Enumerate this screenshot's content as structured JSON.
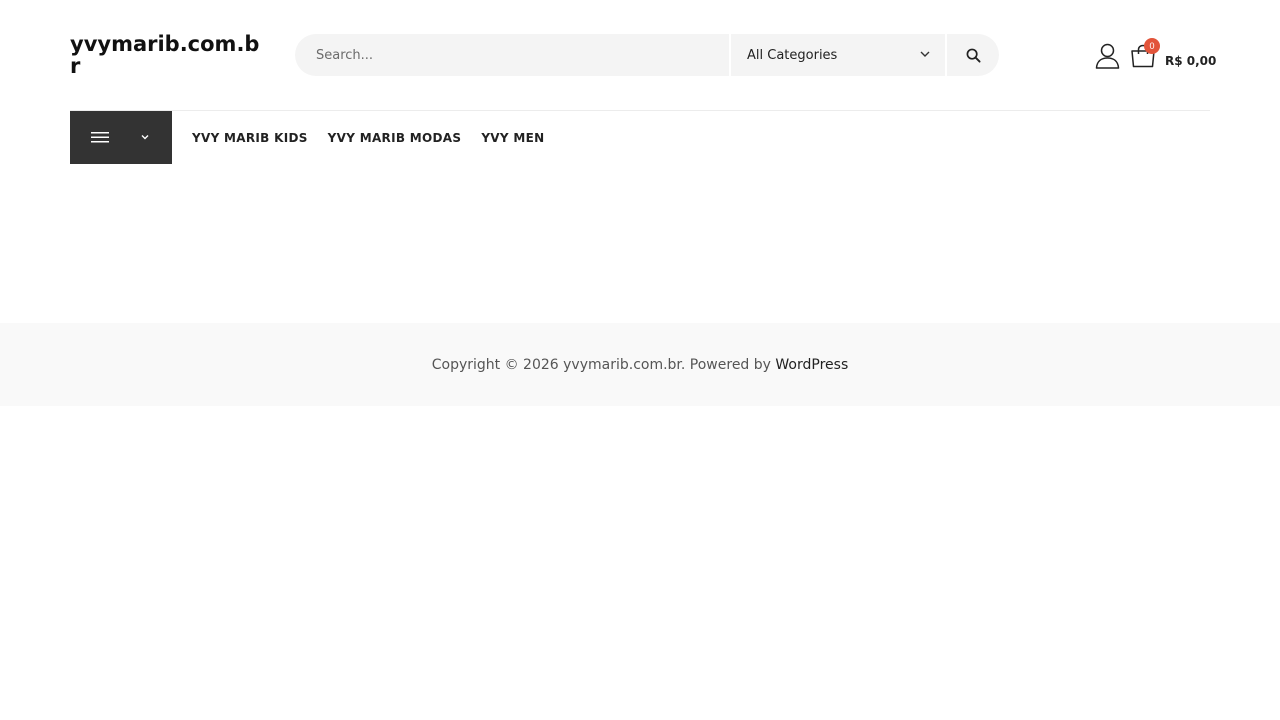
{
  "site": {
    "title": "yvymarib.com.br"
  },
  "search": {
    "placeholder": "Search...",
    "value": "",
    "category_selected": "All Categories"
  },
  "cart": {
    "count": "0",
    "total": "R$ 0,00"
  },
  "nav": {
    "items": [
      {
        "label": "YVY MARIB KIDS"
      },
      {
        "label": "YVY MARIB MODAS"
      },
      {
        "label": "YVY MEN"
      }
    ]
  },
  "footer": {
    "copyright": "Copyright © 2026 yvymarib.com.br. Powered by ",
    "powered_link": "WordPress"
  },
  "colors": {
    "badge": "#e2543a",
    "toggle_bg": "#333333",
    "search_bg": "#f4f4f4",
    "footer_bg": "#f9f9f9"
  },
  "icons": {
    "search": "search-icon",
    "account": "user-icon",
    "cart": "shopping-bag-icon",
    "menu": "hamburger-icon",
    "dropdown": "chevron-down-icon"
  }
}
